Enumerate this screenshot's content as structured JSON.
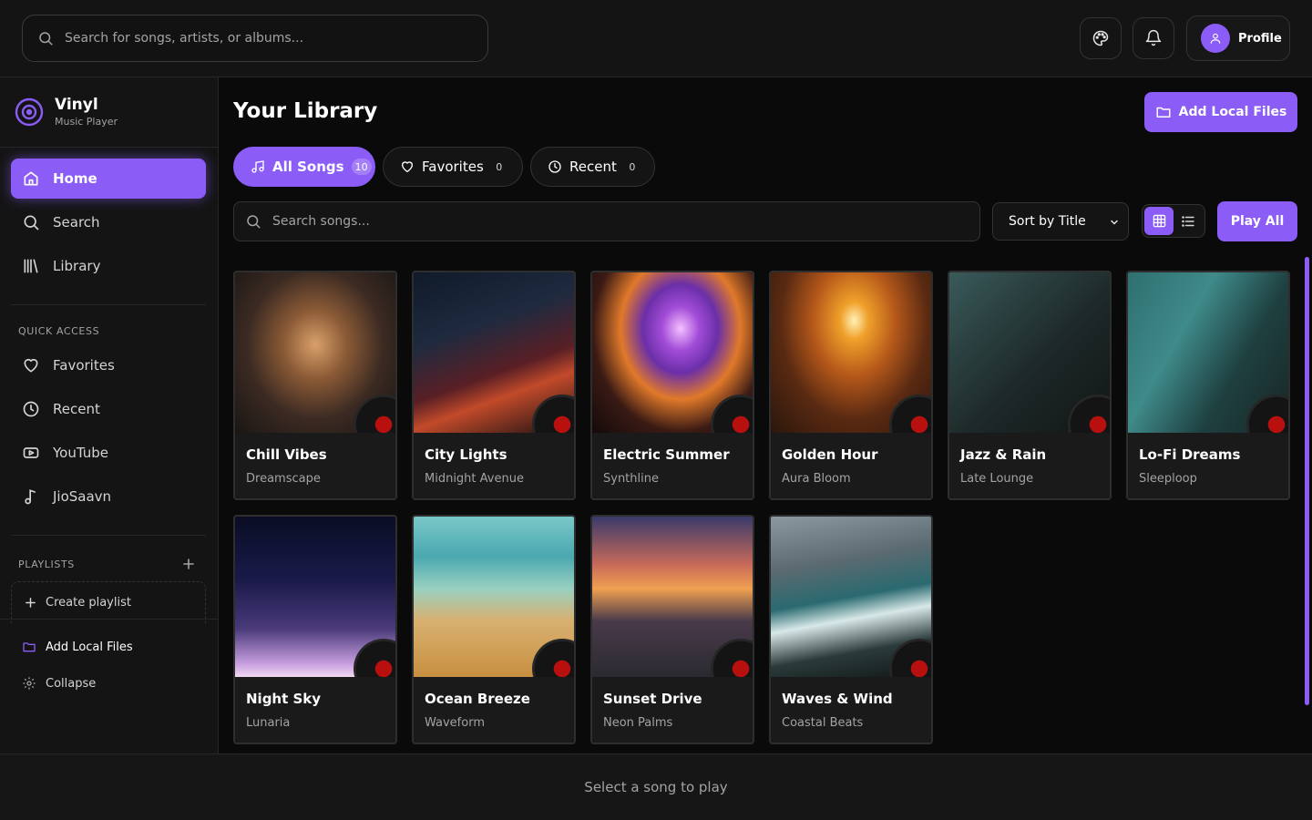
{
  "top_bar": {
    "search_placeholder": "Search for songs, artists, or albums...",
    "profile_label": "Profile"
  },
  "sidebar": {
    "brand_name": "Vinyl",
    "brand_subtitle": "Music Player",
    "nav": [
      {
        "label": "Home",
        "icon": "home-icon",
        "active": true
      },
      {
        "label": "Search",
        "icon": "search-icon"
      },
      {
        "label": "Library",
        "icon": "library-icon"
      }
    ],
    "quick_access_title": "QUICK ACCESS",
    "quick_access": [
      {
        "label": "Favorites",
        "icon": "heart-icon"
      },
      {
        "label": "Recent",
        "icon": "clock-icon"
      },
      {
        "label": "YouTube",
        "icon": "youtube-icon"
      },
      {
        "label": "JioSaavn",
        "icon": "music-note-icon"
      }
    ],
    "playlists_title": "PLAYLISTS",
    "create_playlist_label": "Create playlist",
    "add_local_files_label": "Add Local Files",
    "collapse_label": "Collapse"
  },
  "main": {
    "title": "Your Library",
    "add_local_files_label": "Add Local Files",
    "tabs": [
      {
        "label": "All Songs",
        "count": "10",
        "icon": "music-icon",
        "active": true
      },
      {
        "label": "Favorites",
        "count": "0",
        "icon": "heart-icon"
      },
      {
        "label": "Recent",
        "count": "0",
        "icon": "clock-icon"
      }
    ],
    "search_placeholder": "Search songs...",
    "sort_value": "Sort by Title",
    "view_mode": "grid",
    "play_all_label": "Play All",
    "songs": [
      {
        "title": "Chill Vibes",
        "artist": "Dreamscape"
      },
      {
        "title": "City Lights",
        "artist": "Midnight Avenue"
      },
      {
        "title": "Electric Summer",
        "artist": "Synthline"
      },
      {
        "title": "Golden Hour",
        "artist": "Aura Bloom"
      },
      {
        "title": "Jazz & Rain",
        "artist": "Late Lounge"
      },
      {
        "title": "Lo-Fi Dreams",
        "artist": "Sleeploop"
      },
      {
        "title": "Night Sky",
        "artist": "Lunaria"
      },
      {
        "title": "Ocean Breeze",
        "artist": "Waveform"
      },
      {
        "title": "Sunset Drive",
        "artist": "Neon Palms"
      },
      {
        "title": "Waves & Wind",
        "artist": "Coastal Beats"
      }
    ]
  },
  "player": {
    "status": "Select a song to play"
  },
  "colors": {
    "accent": "#8b5cf6",
    "background": "#0a0a0a",
    "panel": "#141414"
  }
}
